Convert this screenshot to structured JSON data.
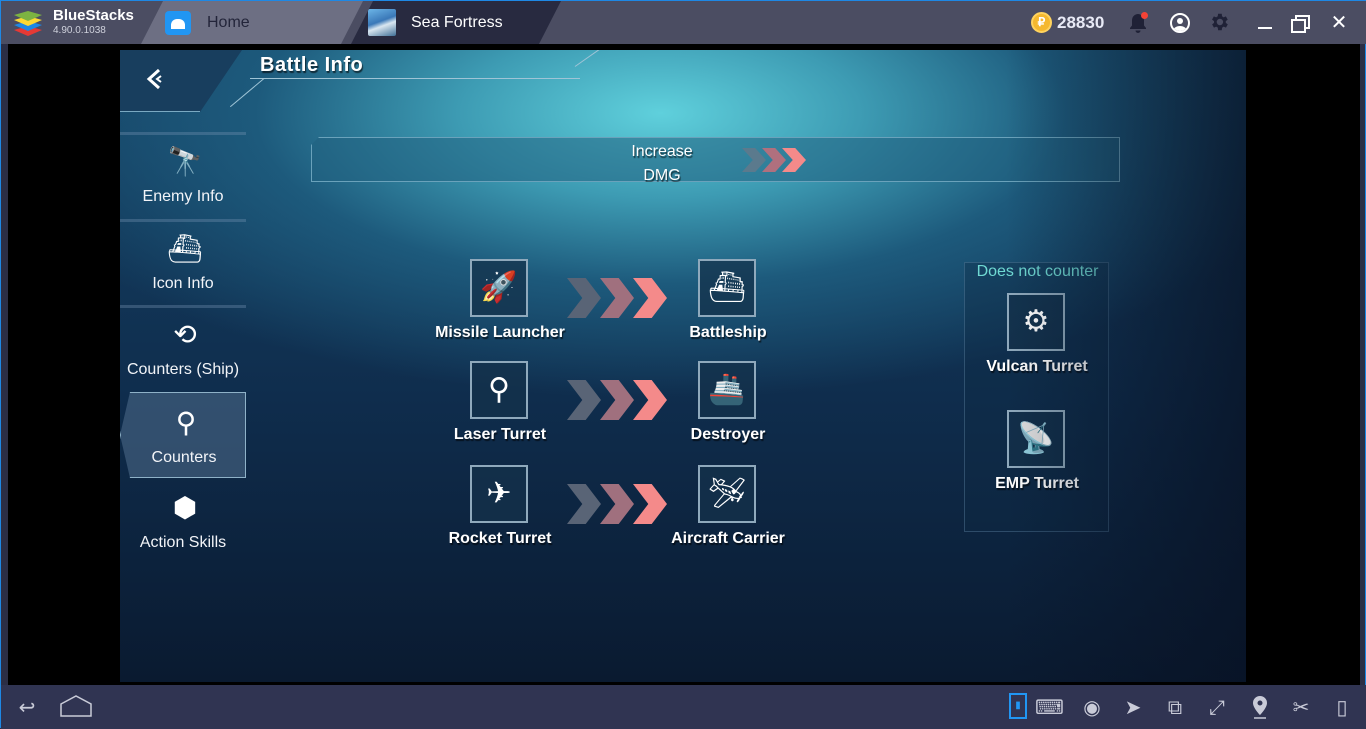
{
  "titlebar": {
    "brand_name": "BlueStacks",
    "brand_version": "4.90.0.1038",
    "tabs": [
      {
        "label": "Home",
        "icon": "home-icon",
        "active": false
      },
      {
        "label": "Sea Fortress",
        "icon": "sea-fortress-game-icon",
        "active": true
      }
    ],
    "coins": {
      "icon": "coin-icon",
      "symbol": "₽",
      "value": "28830"
    },
    "icons": [
      "bell-icon",
      "user-profile-icon",
      "gear-icon",
      "minimize-icon",
      "restore-icon",
      "close-icon"
    ],
    "bell_glyph": "🔔",
    "gear_glyph": "⚙",
    "close_glyph": "✕"
  },
  "game": {
    "header": {
      "back_glyph": "‹",
      "title": "Battle Info"
    },
    "sidebar": [
      {
        "label": "Enemy Info",
        "icon": "binoculars-icon",
        "glyph": "🔭",
        "active": false
      },
      {
        "label": "Icon Info",
        "icon": "sinking-ship-icon",
        "glyph": "⛴",
        "active": false
      },
      {
        "label": "Counters (Ship)",
        "icon": "counter-cycle-icon",
        "glyph": "⟲",
        "active": false
      },
      {
        "label": "Counters",
        "icon": "laser-turret-icon",
        "glyph": "⚲",
        "active": true
      },
      {
        "label": "Action Skills",
        "icon": "cube-skills-icon",
        "glyph": "⬢",
        "active": false
      }
    ],
    "banner": {
      "line1": "Increase",
      "line2": "DMG"
    },
    "counters": [
      {
        "attacker": {
          "label": "Missile Launcher",
          "icon": "missile-launcher-icon",
          "glyph": "🚀"
        },
        "target": {
          "label": "Battleship",
          "icon": "battleship-icon",
          "glyph": "⛴"
        }
      },
      {
        "attacker": {
          "label": "Laser Turret",
          "icon": "laser-turret-icon",
          "glyph": "⚲"
        },
        "target": {
          "label": "Destroyer",
          "icon": "destroyer-icon",
          "glyph": "🚢"
        }
      },
      {
        "attacker": {
          "label": "Rocket Turret",
          "icon": "rocket-turret-icon",
          "glyph": "✈"
        },
        "target": {
          "label": "Aircraft Carrier",
          "icon": "aircraft-carrier-icon",
          "glyph": "🛩"
        }
      }
    ],
    "does_not_counter": {
      "title": "Does not counter",
      "items": [
        {
          "label": "Vulcan Turret",
          "icon": "vulcan-turret-icon",
          "glyph": "⚙"
        },
        {
          "label": "EMP Turret",
          "icon": "emp-turret-icon",
          "glyph": "📡"
        }
      ]
    }
  },
  "bottombar": {
    "left": [
      {
        "name": "back-icon",
        "glyph": "↩"
      },
      {
        "name": "home-outline-icon",
        "glyph": "⌂"
      }
    ],
    "right": [
      {
        "name": "keymapping-toggle-icon",
        "glyph": "▮"
      },
      {
        "name": "keyboard-icon",
        "glyph": "⌨"
      },
      {
        "name": "eye-icon",
        "glyph": "◉"
      },
      {
        "name": "pointer-select-icon",
        "glyph": "➤"
      },
      {
        "name": "rotate-screen-icon",
        "glyph": "⧉"
      },
      {
        "name": "fullscreen-icon",
        "glyph": "⤢"
      },
      {
        "name": "location-icon",
        "glyph": "⚲"
      },
      {
        "name": "scissors-icon",
        "glyph": "✂"
      },
      {
        "name": "shake-device-icon",
        "glyph": "▯"
      }
    ]
  }
}
